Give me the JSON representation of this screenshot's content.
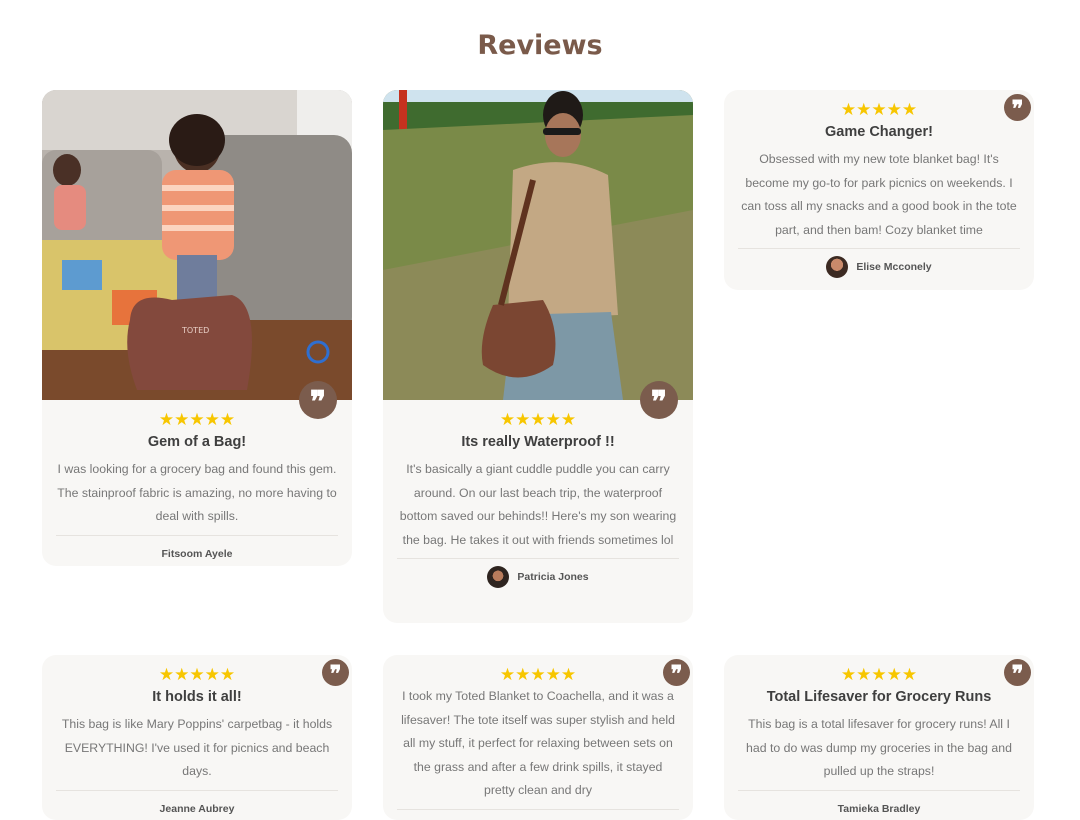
{
  "section": {
    "title": "Reviews"
  },
  "stars": "★★★★★",
  "quote_icon": "❞",
  "reviews": [
    {
      "title": "Gem of a Bag!",
      "text": "I was looking for a grocery bag and found this gem. The stainproof fabric is amazing, no more having to deal with spills.",
      "author": "Fitsoom Ayele",
      "photo": "child-with-brown-tote-photo"
    },
    {
      "title": "Its really Waterproof !!",
      "text": "It's basically a giant cuddle puddle you can carry around. On our last beach trip, the waterproof bottom saved our behinds!! Here's my son wearing the bag. He takes it out with friends sometimes lol",
      "author": "Patricia Jones",
      "photo": "man-with-brown-bag-photo"
    },
    {
      "title": "Game Changer!",
      "text": "Obsessed with my new tote blanket bag! It's become my go-to for park picnics on weekends. I can toss all my snacks and a good book in the tote part, and then bam! Cozy blanket time",
      "author": "Elise Mcconely"
    },
    {
      "title": "It holds it all!",
      "text": "This bag is like Mary Poppins' carpetbag - it holds EVERYTHING! I've used it for picnics and beach days.",
      "author": "Jeanne Aubrey"
    },
    {
      "title": "",
      "text": "I took my Toted Blanket to Coachella, and it was a lifesaver! The tote itself was super stylish and held all my stuff, it perfect for relaxing between sets on the grass and after a few drink spills, it stayed pretty clean and dry",
      "author": ""
    },
    {
      "title": "Total Lifesaver for Grocery Runs",
      "text": "This bag is a total lifesaver for grocery runs! All I had to do was dump my groceries in the bag and pulled up the straps!",
      "author": "Tamieka Bradley"
    }
  ],
  "colors": {
    "accent": "#7b5c4d",
    "star": "#f7c600",
    "card_bg": "#f8f7f5",
    "title": "#7a5a4a"
  }
}
